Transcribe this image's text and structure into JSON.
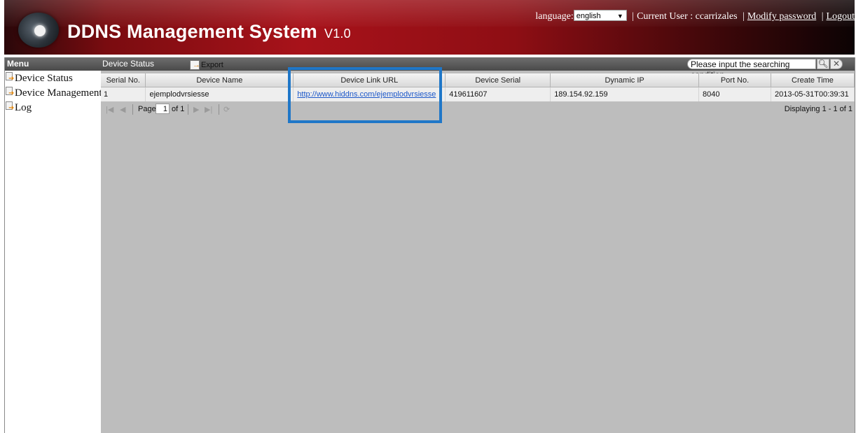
{
  "header": {
    "title": "DDNS Management System",
    "version": "V1.0",
    "language_label": "language:",
    "language_value": "english",
    "current_user_label": "Current User : ccarrizales",
    "modify_password": "Modify password",
    "logout": "Logout",
    "separator": "|"
  },
  "sidebar": {
    "header": "Menu",
    "items": [
      {
        "label": "Device Status",
        "icon": "page-arrow-icon"
      },
      {
        "label": "Device Management",
        "icon": "page-arrow-icon"
      },
      {
        "label": "Log",
        "icon": "page-arrow-icon"
      }
    ]
  },
  "panel": {
    "title": "Device Status",
    "export_label": "Export",
    "search_placeholder": "Please input the searching condition",
    "search_icon": "search-icon",
    "clear_icon": "close-icon"
  },
  "table": {
    "columns": [
      "Serial No.",
      "Device Name",
      "Device Link URL",
      "Device Serial",
      "Dynamic IP",
      "Port No.",
      "Create Time"
    ],
    "rows": [
      [
        "1",
        "ejemplodvrsiesse",
        "http://www.hiddns.com/ejemplodvrsiesse",
        "419611607",
        "189.154.92.159",
        "8040",
        "2013-05-31T00:39:31"
      ]
    ]
  },
  "pager": {
    "page_label": "Page",
    "page_value": "1",
    "of_label": "of 1",
    "displaying": "Displaying 1 - 1 of 1"
  },
  "colors": {
    "header_red": "#a8121a",
    "highlight_blue": "#1f77c8",
    "link_blue": "#1b57c9"
  }
}
